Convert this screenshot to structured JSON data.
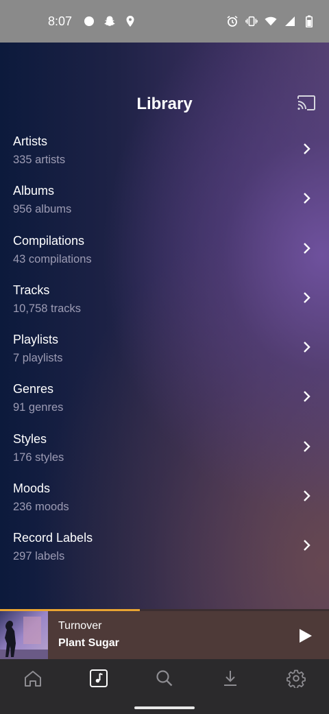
{
  "status_bar": {
    "time": "8:07",
    "left_icons": [
      "notification-circle-icon",
      "snapchat-icon",
      "location-pin-icon"
    ],
    "right_icons": [
      "alarm-icon",
      "vibrate-icon",
      "wifi-icon",
      "signal-icon",
      "battery-icon"
    ]
  },
  "header": {
    "title": "Library",
    "cast_icon": "cast-icon"
  },
  "library": {
    "items": [
      {
        "name": "Artists",
        "count": "335 artists"
      },
      {
        "name": "Albums",
        "count": "956 albums"
      },
      {
        "name": "Compilations",
        "count": "43 compilations"
      },
      {
        "name": "Tracks",
        "count": "10,758 tracks"
      },
      {
        "name": "Playlists",
        "count": "7 playlists"
      },
      {
        "name": "Genres",
        "count": "91 genres"
      },
      {
        "name": "Styles",
        "count": "176 styles"
      },
      {
        "name": "Moods",
        "count": "236 moods"
      },
      {
        "name": "Record Labels",
        "count": "297 labels"
      }
    ]
  },
  "now_playing": {
    "title": "Turnover",
    "artist": "Plant Sugar",
    "progress": 0.425,
    "progress_color": "#e9a431"
  },
  "bottom_nav": {
    "items": [
      {
        "icon": "home-icon",
        "active": false
      },
      {
        "icon": "music-library-icon",
        "active": true
      },
      {
        "icon": "search-icon",
        "active": false
      },
      {
        "icon": "download-icon",
        "active": false
      },
      {
        "icon": "settings-gear-icon",
        "active": false
      }
    ]
  }
}
